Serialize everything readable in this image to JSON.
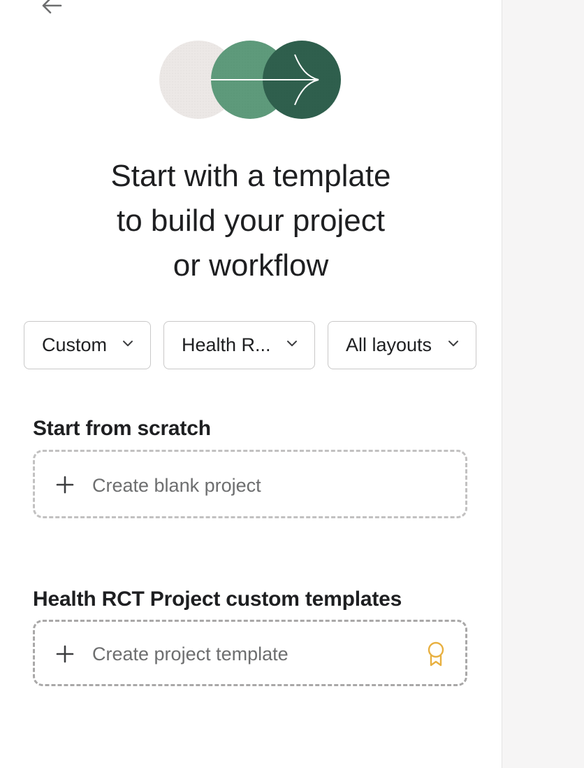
{
  "headline": {
    "line1": "Start with a template",
    "line2": "to build your project",
    "line3": "or workflow"
  },
  "filters": [
    {
      "label": "Custom",
      "icon": "chevron-down-icon"
    },
    {
      "label": "Health R...",
      "icon": "chevron-down-icon"
    },
    {
      "label": "All layouts",
      "icon": "chevron-down-icon"
    }
  ],
  "scratch": {
    "title": "Start from scratch",
    "create_label": "Create blank project",
    "icon": "plus-icon"
  },
  "custom_templates": {
    "title": "Health RCT Project custom templates",
    "create_label": "Create project template",
    "icon": "plus-icon",
    "badge_icon": "award-ribbon-icon"
  },
  "colors": {
    "accent_light_green": "#5e9a7b",
    "accent_dark_green": "#2f5f4d",
    "circle_grey": "#ece8e6",
    "badge_gold": "#e8b040",
    "border": "#c9c8c8",
    "muted_text": "#6d6e6f"
  }
}
